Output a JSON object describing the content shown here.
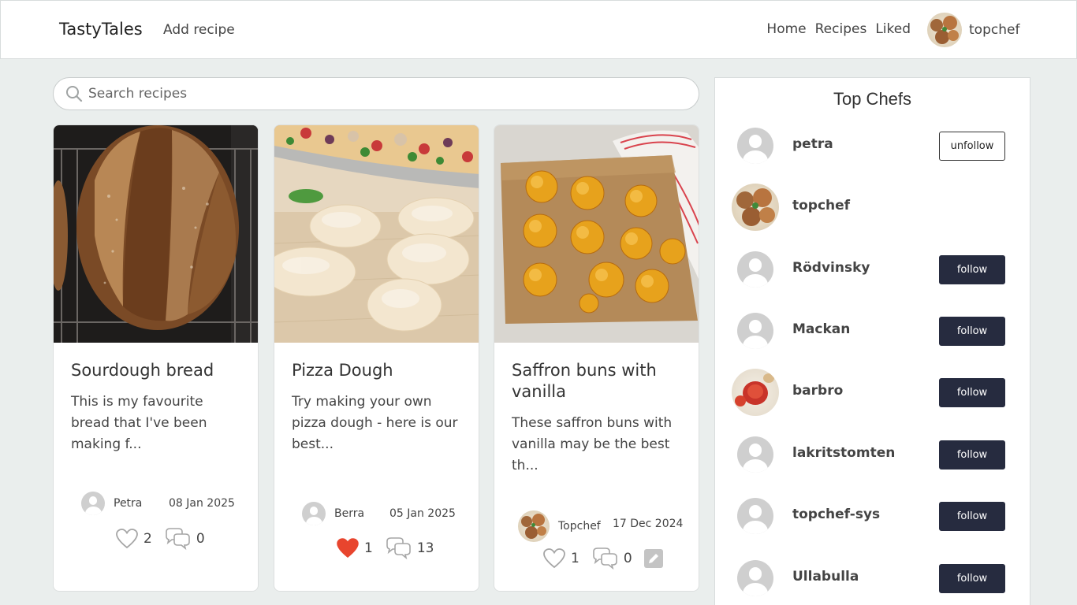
{
  "nav": {
    "brand": "TastyTales",
    "add_recipe": "Add recipe",
    "links": [
      "Home",
      "Recipes",
      "Liked"
    ],
    "username": "topchef"
  },
  "search": {
    "placeholder": "Search recipes"
  },
  "recipes": [
    {
      "title": "Sourdough bread",
      "excerpt": "This is my favourite bread that I've been making f...",
      "author": "Petra",
      "date": "08 Jan 2025",
      "likes": "2",
      "comments": "0",
      "liked": false
    },
    {
      "title": "Pizza Dough",
      "excerpt": "Try making your own pizza dough - here is our best...",
      "author": "Berra",
      "date": "05 Jan 2025",
      "likes": "1",
      "comments": "13",
      "liked": true
    },
    {
      "title": "Saffron buns with vanilla",
      "excerpt": "These saffron buns with vanilla may be the best th...",
      "author": "Topchef",
      "date": "17 Dec 2024",
      "likes": "1",
      "comments": "0",
      "liked": false
    }
  ],
  "sidebar": {
    "title": "Top Chefs",
    "chefs": [
      {
        "name": "petra",
        "button": "unfollow"
      },
      {
        "name": "topchef",
        "button": ""
      },
      {
        "name": "Rödvinsky",
        "button": "follow"
      },
      {
        "name": "Mackan",
        "button": "follow"
      },
      {
        "name": "barbro",
        "button": "follow"
      },
      {
        "name": "lakritstomten",
        "button": "follow"
      },
      {
        "name": "topchef-sys",
        "button": "follow"
      },
      {
        "name": "Ullabulla",
        "button": "follow"
      }
    ]
  },
  "colors": {
    "follow_button": "#262b3f",
    "liked_heart": "#e8452e",
    "background": "#eaeeed"
  }
}
